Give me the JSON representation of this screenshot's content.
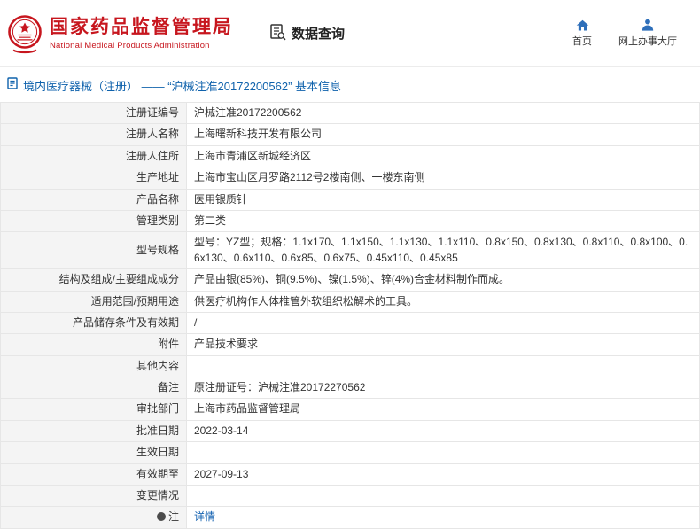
{
  "header": {
    "org_cn": "国家药品监督管理局",
    "org_en": "National Medical Products Administration",
    "nav_query": "数据查询",
    "nav_home": "首页",
    "nav_hall": "网上办事大厅"
  },
  "breadcrumb": {
    "title": "境内医疗器械（注册） —— “沪械注准20172200562” 基本信息"
  },
  "colors": {
    "brand_red": "#c7161e",
    "title_blue": "#0f62ac",
    "link_blue": "#1a66b3",
    "label_bg": "#f4f4f4",
    "border": "#e6e6e6"
  },
  "icons": [
    "national-emblem-logo",
    "data-query-icon",
    "home-icon",
    "user-icon",
    "document-icon",
    "note-icon"
  ],
  "table": {
    "rows": [
      {
        "label": "注册证编号",
        "value": "沪械注准20172200562"
      },
      {
        "label": "注册人名称",
        "value": "上海曙新科技开发有限公司"
      },
      {
        "label": "注册人住所",
        "value": "上海市青浦区新城经济区"
      },
      {
        "label": "生产地址",
        "value": "上海市宝山区月罗路2112号2楼南侧、一楼东南侧"
      },
      {
        "label": "产品名称",
        "value": "医用银质针"
      },
      {
        "label": "管理类别",
        "value": "第二类"
      },
      {
        "label": "型号规格",
        "value": "型号：YZ型；规格：1.1x170、1.1x150、1.1x130、1.1x110、0.8x150、0.8x130、0.8x110、0.8x100、0.6x130、0.6x110、0.6x85、0.6x75、0.45x110、0.45x85"
      },
      {
        "label": "结构及组成/主要组成成分",
        "value": "产品由银(85%)、铜(9.5%)、镍(1.5%)、锌(4%)合金材料制作而成。"
      },
      {
        "label": "适用范围/预期用途",
        "value": "供医疗机构作人体椎管外软组织松解术的工具。"
      },
      {
        "label": "产品储存条件及有效期",
        "value": "/"
      },
      {
        "label": "附件",
        "value": "产品技术要求"
      },
      {
        "label": "其他内容",
        "value": ""
      },
      {
        "label": "备注",
        "value": "原注册证号：沪械注准20172270562"
      },
      {
        "label": "审批部门",
        "value": "上海市药品监督管理局"
      },
      {
        "label": "批准日期",
        "value": "2022-03-14"
      },
      {
        "label": "生效日期",
        "value": ""
      },
      {
        "label": "有效期至",
        "value": "2027-09-13"
      },
      {
        "label": "变更情况",
        "value": ""
      },
      {
        "label": "注",
        "value": "详情",
        "link": true,
        "label_icon": "note-icon"
      }
    ]
  }
}
